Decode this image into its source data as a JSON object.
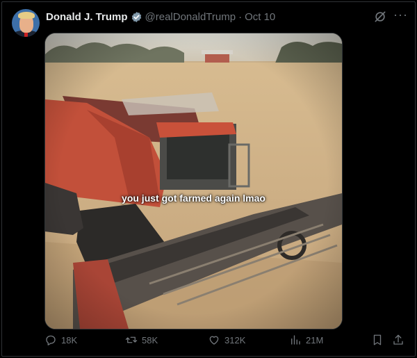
{
  "tweet": {
    "author_name": "Donald J. Trump",
    "handle": "@realDonaldTrump",
    "separator": "·",
    "date": "Oct 10",
    "more_glyph": "···"
  },
  "media": {
    "caption": "you just got farmed again lmao"
  },
  "actions": {
    "replies": "18K",
    "reposts": "58K",
    "likes": "312K",
    "views": "21M"
  },
  "colors": {
    "background": "#000000",
    "text_primary": "#e7e9ea",
    "text_secondary": "#71767b",
    "verified": "#1d9bf0"
  }
}
